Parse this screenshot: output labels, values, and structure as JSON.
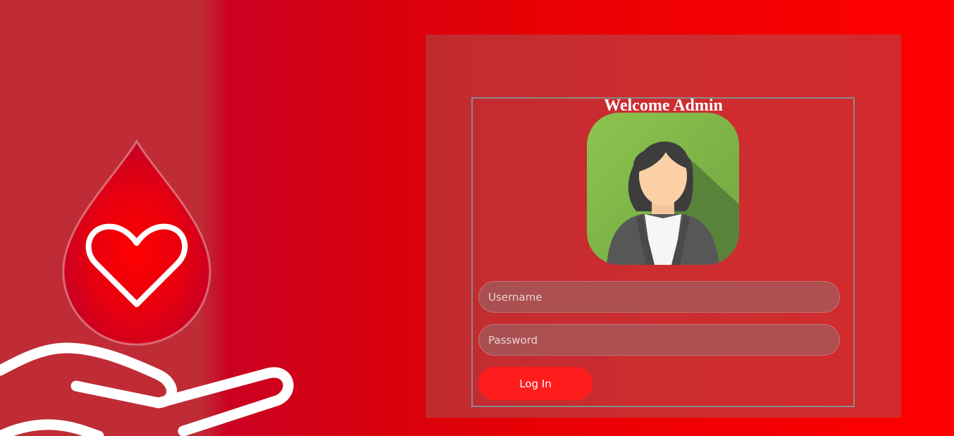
{
  "login": {
    "title": "Welcome Admin",
    "username_placeholder": "Username",
    "password_placeholder": "Password",
    "submit_label": "Log In"
  },
  "icons": {
    "hero": "blood-drop-heart-hand-icon",
    "avatar": "admin-avatar-icon"
  },
  "colors": {
    "background_left": "#c02c36",
    "background_right": "#ff0000",
    "panel": "#cc2d30",
    "button": "#ff1c1c"
  }
}
